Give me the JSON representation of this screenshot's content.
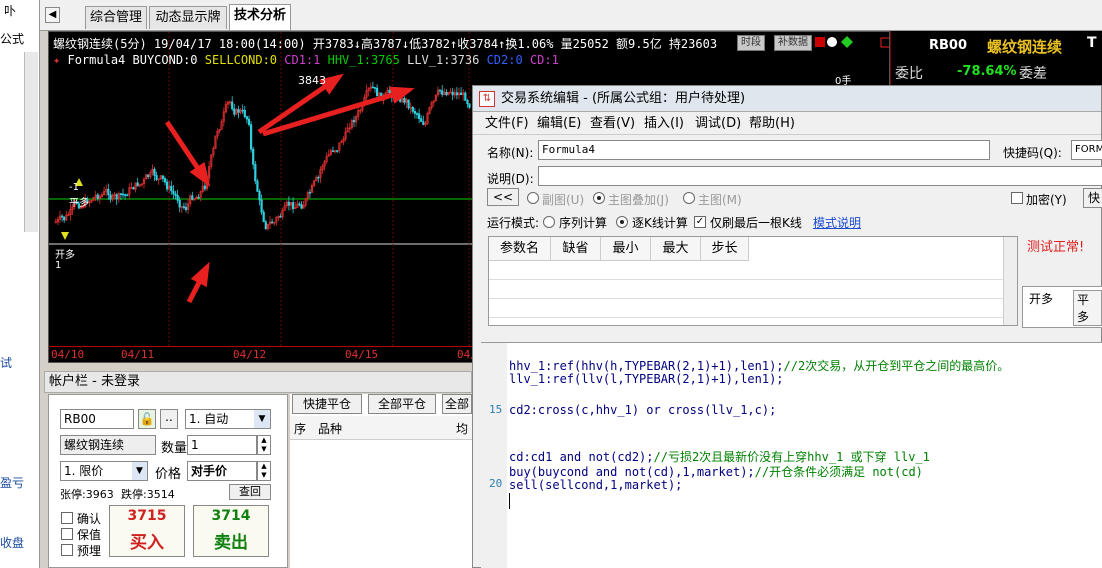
{
  "left_strip": {
    "labels": [
      "公式",
      "试",
      "盈亏",
      "收盘"
    ],
    "top_glyph": "卟"
  },
  "tabs": [
    "综合管理",
    "动态显示牌",
    "技术分析"
  ],
  "chart": {
    "info": "螺纹钢连续(5分) 19/04/17 18:00(14:00) 开3783↓高3787↓低3782↑收3784↑换1.06% 量25052 额9.5亿 持23603",
    "btn_period": "时段",
    "btn_fill": "补数据",
    "formula": "Formula4",
    "buycond": "BUYCOND:0",
    "sellcond": "SELLCOND:0",
    "cd1": "CD1:1",
    "hhv": "HHV_1:3765",
    "llv": "LLV_1:3736",
    "cd2": "CD2:0",
    "cd": "CD:1",
    "peak": "3843",
    "lowlabel1": "-1",
    "lowlabel2": "平多",
    "buy_label": "开多",
    "buy_num": "1",
    "right_axis": "0手",
    "dates": [
      "04/10",
      "04/11",
      "04/12",
      "04/15",
      "04/"
    ]
  },
  "quote": {
    "code": "RB00",
    "name": "螺纹钢连续",
    "ratio_label": "委比",
    "ratio_value": "-78.64%",
    "diff_label": "委差",
    "letter": "T"
  },
  "account": {
    "title": "帐户栏 - 未登录",
    "code": "RB00",
    "auto": "1. 自动",
    "name": "螺纹钢连续",
    "qty_label": "数量",
    "qty": "1",
    "price_type": "1. 限价",
    "price_label": "价格",
    "price": "对手价",
    "limit_up": "张停:3963",
    "limit_down": "跌停:3514",
    "query": "查回",
    "confirm": "确认",
    "keep": "保值",
    "preset": "预埋",
    "buy_price": "3715",
    "buy_label": "买入",
    "sell_price": "3714",
    "sell_label": "卖出",
    "btn_quick": "快捷平仓",
    "btn_all": "全部平仓",
    "btn_all2": "全部",
    "col_seq": "序",
    "col_item": "品种",
    "col_avg": "均"
  },
  "dialog": {
    "title": "交易系统编辑 - (所属公式组：用户待处理)",
    "menus": [
      "文件(F)",
      "编辑(E)",
      "查看(V)",
      "插入(I)",
      "调试(D)",
      "帮助(H)"
    ],
    "name_label": "名称(N):",
    "name_value": "Formula4",
    "shortcut_label": "快捷码(Q):",
    "shortcut_value": "FORMU",
    "desc_label": "说明(D):",
    "back_btn": "<<",
    "opt_sub": "副图(U)",
    "opt_overlay": "主图叠加(J)",
    "opt_main": "主图(M)",
    "encrypt": "加密(Y)",
    "ok_btn": "快",
    "mode_label": "运行模式:",
    "mode_seq": "序列计算",
    "mode_tick": "逐K线计算",
    "mode_last": "仅刷最后一根K线",
    "mode_help": "模式说明",
    "columns": [
      "参数名",
      "缺省",
      "最小",
      "最大",
      "步长"
    ],
    "test_ok": "测试正常!",
    "tab_open": "开多",
    "tab_close": "平多",
    "line_numbers": [
      "15",
      "20"
    ],
    "code": [
      [
        "hhv_1:ref(hhv(h,TYPEBAR(2,1)+1),len1);",
        "//2次交易，从开仓到平仓之间的最高价。"
      ],
      [
        "llv_1:ref(llv(l,TYPEBAR(2,1)+1),len1);",
        ""
      ],
      [
        "",
        ""
      ],
      [
        "cd2:cross(c,hhv_1) or cross(llv_1,c);",
        ""
      ],
      [
        "",
        ""
      ],
      [
        "cd:cd1 and not(cd2);",
        "//亏损2次且最新价没有上穿hhv_1 或下穿 llv_1"
      ],
      [
        "buy(buycond and not(cd),1,market);",
        "//开仓条件必须满足 not(cd)"
      ],
      [
        "sell(sellcond,1,market);",
        ""
      ]
    ]
  },
  "colors": {
    "chart_bg": "#000000",
    "up": "#e03030",
    "down": "#30d0e0",
    "hhv_line": "#00cc00",
    "llv_line": "#dddddd",
    "arrow": "#e82020"
  }
}
